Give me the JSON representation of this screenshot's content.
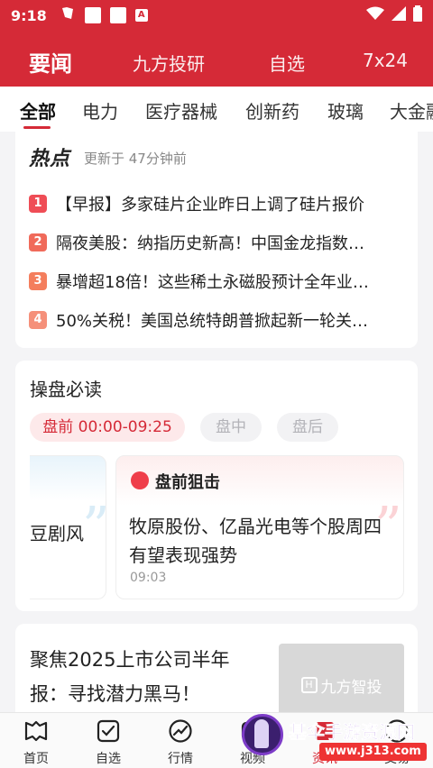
{
  "status_bar": {
    "time": "9:18",
    "badge": "A"
  },
  "header": {
    "tabs": [
      {
        "label": "要闻"
      },
      {
        "label": "九方投研"
      },
      {
        "label": "自选"
      },
      {
        "label": "7x24"
      }
    ]
  },
  "categories": [
    "全部",
    "电力",
    "医疗器械",
    "创新药",
    "玻璃",
    "大金融"
  ],
  "hot": {
    "title": "热点",
    "updated": "更新于 47分钟前",
    "items": [
      {
        "rank": "1",
        "text": "【早报】多家硅片企业昨日上调了硅片报价"
      },
      {
        "rank": "2",
        "text": "隔夜美股：纳指历史新高！中国金龙指数…"
      },
      {
        "rank": "3",
        "text": "暴增超18倍！这些稀土永磁股预计全年业…"
      },
      {
        "rank": "4",
        "text": "50%关税！美国总统特朗普掀起新一轮关…"
      }
    ]
  },
  "operation": {
    "title": "操盘必读",
    "pills": [
      "盘前 00:00-09:25",
      "盘中",
      "盘后"
    ],
    "left_card_text": "豆剧风",
    "main_card": {
      "label": "盘前狙击",
      "title": "牧原股份、亿晶光电等个股周四有望表现强势",
      "time": "09:03"
    }
  },
  "article": {
    "title": "聚焦2025上市公司半年报：寻找潜力黑马！",
    "thumb_text": "九方智投",
    "thumb_logo": "H"
  },
  "bottom_nav": [
    {
      "label": "首页",
      "icon": "home-icon"
    },
    {
      "label": "自选",
      "icon": "checkbox-icon"
    },
    {
      "label": "行情",
      "icon": "market-trend-icon"
    },
    {
      "label": "视频",
      "icon": "video-icon"
    },
    {
      "label": "资讯",
      "icon": "news-icon"
    },
    {
      "label": "交易",
      "icon": "trade-icon"
    }
  ],
  "watermark": {
    "text": "基伞手游资源网",
    "url": "www.j313.com"
  },
  "colors": {
    "brand": "#d52a37",
    "pill_active_bg": "#fde9ea"
  }
}
